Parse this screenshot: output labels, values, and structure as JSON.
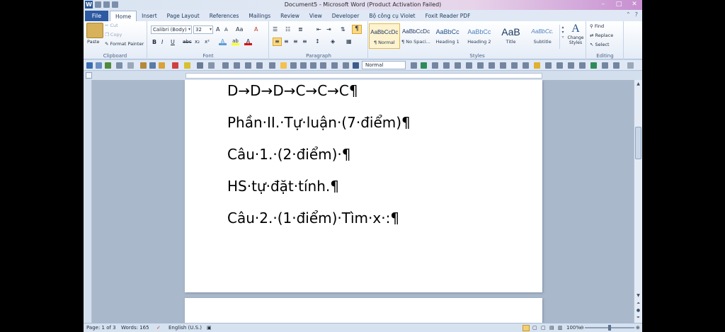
{
  "window": {
    "title": "Document5 - Microsoft Word (Product Activation Failed)",
    "app_icon_letter": "W"
  },
  "tabs": {
    "file": "File",
    "items": [
      "Home",
      "Insert",
      "Page Layout",
      "References",
      "Mailings",
      "Review",
      "View",
      "Developer",
      "Bộ công cụ Violet",
      "Foxit Reader PDF"
    ],
    "active": "Home"
  },
  "ribbon": {
    "clipboard": {
      "label": "Clipboard",
      "paste": "Paste",
      "cut": "Cut",
      "copy": "Copy",
      "format_painter": "Format Painter"
    },
    "font": {
      "label": "Font",
      "family": "Calibri (Body)",
      "size": "32",
      "bold": "B",
      "italic": "I",
      "underline": "U",
      "strike": "abc",
      "subscript": "x₂",
      "superscript": "x²",
      "grow": "A",
      "shrink": "A",
      "change_case": "Aa",
      "clear": "A"
    },
    "paragraph": {
      "label": "Paragraph"
    },
    "styles": {
      "label": "Styles",
      "items": [
        {
          "sample": "AaBbCcDc",
          "name": "¶ Normal"
        },
        {
          "sample": "AaBbCcDc",
          "name": "¶ No Spaci..."
        },
        {
          "sample": "AaBbCc",
          "name": "Heading 1"
        },
        {
          "sample": "AaBbCc",
          "name": "Heading 2"
        },
        {
          "sample": "AaB",
          "name": "Title"
        },
        {
          "sample": "AaBbCc.",
          "name": "Subtitle"
        }
      ],
      "selected_index": 0,
      "change_styles": "Change Styles"
    },
    "editing": {
      "label": "Editing",
      "find": "Find",
      "replace": "Replace",
      "select": "Select"
    }
  },
  "qat": {
    "style_box": "Normal"
  },
  "document": {
    "paragraphs": [
      "D→D→D→C→C→C¶",
      "Phần·II.·Tự·luận·(7·điểm)¶",
      "Câu·1.·(2·điểm)·¶",
      "HS·tự·đặt·tính.¶",
      "Câu·2.·(1·điểm)·Tìm·x·:¶"
    ]
  },
  "status": {
    "page": "Page: 1 of 3",
    "words": "Words: 165",
    "language": "English (U.S.)",
    "zoom": "100%"
  },
  "colors": {
    "file_tab": "#2d5aa3",
    "ribbon_bg": "#e4ecf7",
    "doc_bg": "#a9b8cb",
    "selected_style": "#fdf3cf"
  }
}
